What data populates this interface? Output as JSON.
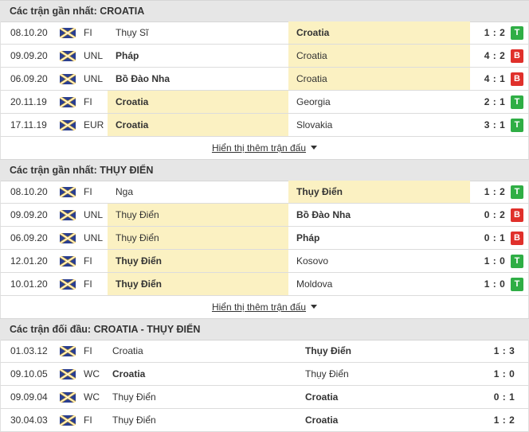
{
  "sections": [
    {
      "title": "Các trận gần nhất: CROATIA",
      "more_label": "Hiển thị thêm trận đấu",
      "rows": [
        {
          "date": "08.10.20",
          "comp": "FI",
          "home": "Thụy Sĩ",
          "away": "Croatia",
          "score": "1 : 2",
          "result": "T",
          "hl": "away"
        },
        {
          "date": "09.09.20",
          "comp": "UNL",
          "home": "Pháp",
          "away": "Croatia",
          "score": "4 : 2",
          "result": "B",
          "hl": "away"
        },
        {
          "date": "06.09.20",
          "comp": "UNL",
          "home": "Bồ Đào Nha",
          "away": "Croatia",
          "score": "4 : 1",
          "result": "B",
          "hl": "away"
        },
        {
          "date": "20.11.19",
          "comp": "FI",
          "home": "Croatia",
          "away": "Georgia",
          "score": "2 : 1",
          "result": "T",
          "hl": "home"
        },
        {
          "date": "17.11.19",
          "comp": "EUR",
          "home": "Croatia",
          "away": "Slovakia",
          "score": "3 : 1",
          "result": "T",
          "hl": "home"
        }
      ]
    },
    {
      "title": "Các trận gần nhất: THỤY ĐIỂN",
      "more_label": "Hiển thị thêm trận đấu",
      "rows": [
        {
          "date": "08.10.20",
          "comp": "FI",
          "home": "Nga",
          "away": "Thụy Điển",
          "score": "1 : 2",
          "result": "T",
          "hl": "away"
        },
        {
          "date": "09.09.20",
          "comp": "UNL",
          "home": "Thụy Điển",
          "away": "Bồ Đào Nha",
          "score": "0 : 2",
          "result": "B",
          "hl": "home"
        },
        {
          "date": "06.09.20",
          "comp": "UNL",
          "home": "Thụy Điển",
          "away": "Pháp",
          "score": "0 : 1",
          "result": "B",
          "hl": "home"
        },
        {
          "date": "12.01.20",
          "comp": "FI",
          "home": "Thụy Điển",
          "away": "Kosovo",
          "score": "1 : 0",
          "result": "T",
          "hl": "home"
        },
        {
          "date": "10.01.20",
          "comp": "FI",
          "home": "Thụy Điển",
          "away": "Moldova",
          "score": "1 : 0",
          "result": "T",
          "hl": "home"
        }
      ]
    },
    {
      "title": "Các trận đối đầu: CROATIA - THỤY ĐIỂN",
      "rows": [
        {
          "date": "01.03.12",
          "comp": "FI",
          "home": "Croatia",
          "away": "Thụy Điển",
          "score": "1 : 3"
        },
        {
          "date": "09.10.05",
          "comp": "WC",
          "home": "Croatia",
          "away": "Thụy Điển",
          "score": "1 : 0"
        },
        {
          "date": "09.09.04",
          "comp": "WC",
          "home": "Thụy Điển",
          "away": "Croatia",
          "score": "0 : 1"
        },
        {
          "date": "30.04.03",
          "comp": "FI",
          "home": "Thụy Điển",
          "away": "Croatia",
          "score": "1 : 2"
        }
      ]
    }
  ],
  "icons": {
    "competition": "flag-icon",
    "expand": "caret-down-icon"
  },
  "colors": {
    "win": "#2fae45",
    "loss": "#e0302b",
    "highlight": "#fbf1c2",
    "header_bg": "#e6e6e6"
  }
}
